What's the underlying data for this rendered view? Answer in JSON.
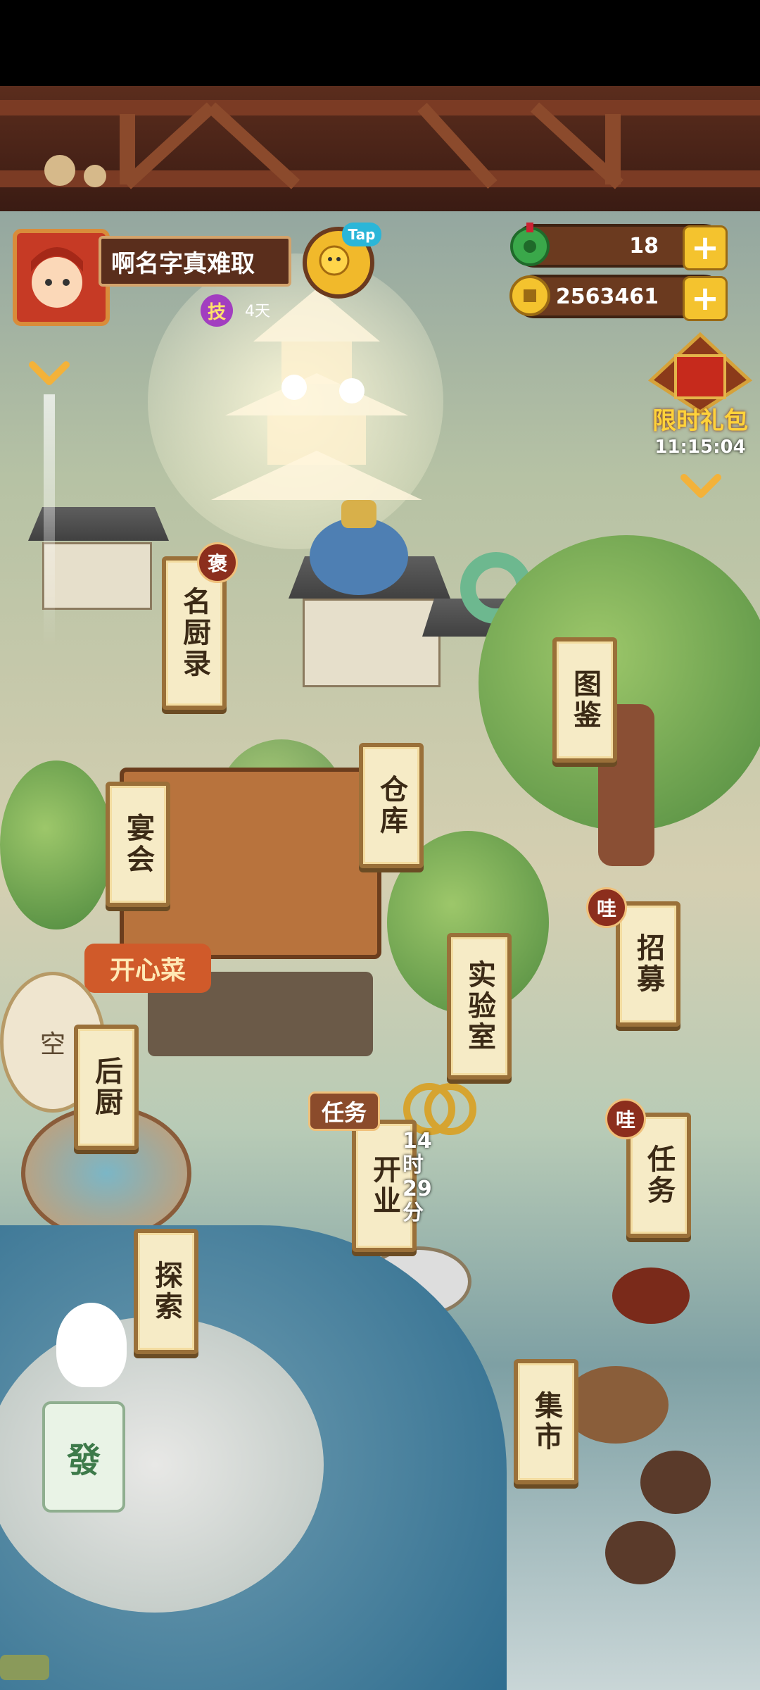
{
  "player": {
    "name": "啊名字真难取",
    "skill_badge": "技",
    "skill_days": "4天",
    "tap_label": "Tap"
  },
  "currency": {
    "jade_amount": "18",
    "coin_amount": "2563461"
  },
  "promo": {
    "title": "限时礼包",
    "timer": "11:15:04"
  },
  "map": {
    "buildings": [
      {
        "id": "chef-records",
        "label": "名厨录",
        "badge": "褒"
      },
      {
        "id": "illustrations",
        "label": "图鉴"
      },
      {
        "id": "warehouse",
        "label": "仓库"
      },
      {
        "id": "banquet",
        "label": "宴会"
      },
      {
        "id": "recruit",
        "label": "招募",
        "badge": "哇"
      },
      {
        "id": "lab",
        "label": "实验室"
      },
      {
        "id": "kitchen",
        "label": "后厨"
      },
      {
        "id": "open-business",
        "label": "开业",
        "badge": "任务",
        "timer": "14时29分"
      },
      {
        "id": "tasks",
        "label": "任务",
        "badge": "哇"
      },
      {
        "id": "explore",
        "label": "探索"
      },
      {
        "id": "market",
        "label": "集市"
      }
    ],
    "shop_sign": "开心菜",
    "fan_text": "空",
    "tile_text": "發"
  },
  "colors": {
    "roof_brown": "#5b2d1d",
    "banner_paper": "#f6ebc6",
    "badge_red": "#8c2e1d",
    "gold": "#f4c32e"
  }
}
